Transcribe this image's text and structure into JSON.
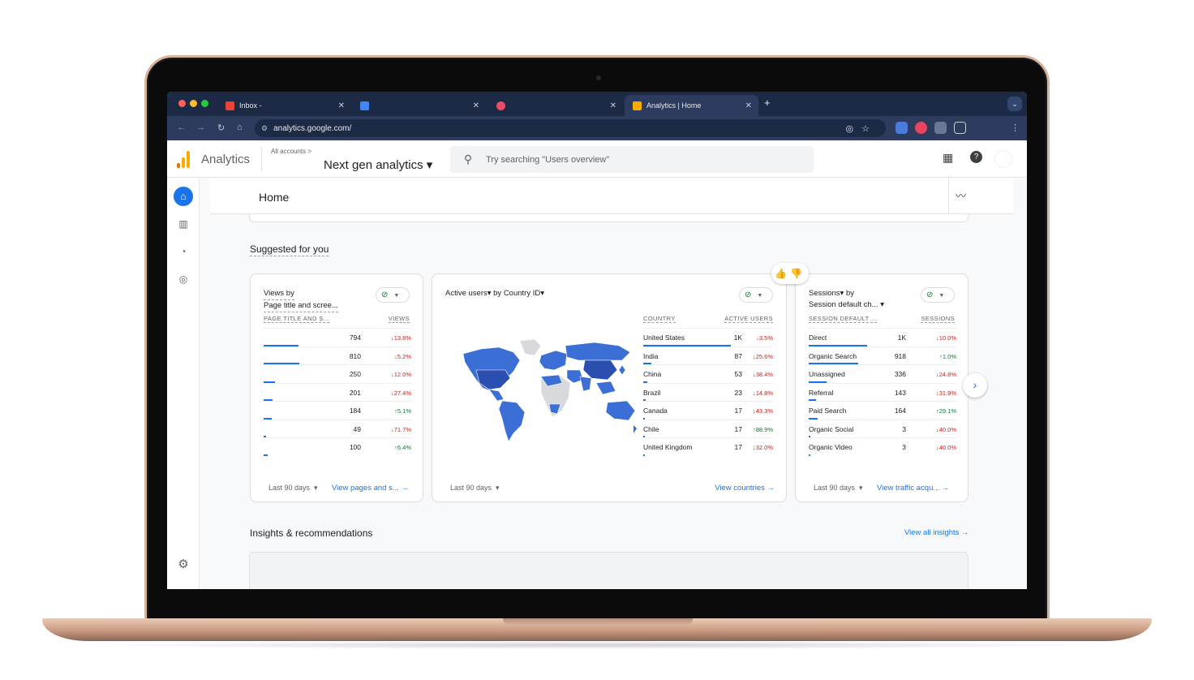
{
  "browser": {
    "tabs": [
      {
        "label": "Inbox -",
        "favicon_color": "#ea4335"
      },
      {
        "label": "",
        "favicon_color": "#4285f4"
      },
      {
        "label": "",
        "favicon_color": "#ea4c6a"
      },
      {
        "label": "Analytics | Home",
        "favicon_color": "#f9ab00"
      }
    ],
    "new_tab": "+",
    "url": "analytics.google.com/"
  },
  "ga_header": {
    "app_name": "Analytics",
    "all_accounts": "All accounts >",
    "property": "Next gen analytics ▾",
    "search_placeholder": "Try searching \"Users overview\""
  },
  "page": {
    "title": "Home"
  },
  "suggested": {
    "heading": "Suggested for you",
    "cards": [
      {
        "title_line1": "Views by",
        "title_line2": "Page title and scree...",
        "col_left": "PAGE TITLE AND S...",
        "col_right": "VIEWS",
        "rows": [
          {
            "label": "",
            "value": "794",
            "change": "↓13.8%",
            "dir": "down",
            "share": 0.98
          },
          {
            "label": "",
            "value": "810",
            "change": "↓5.2%",
            "dir": "down",
            "share": 1.0
          },
          {
            "label": "",
            "value": "250",
            "change": "↓12.0%",
            "dir": "down",
            "share": 0.31
          },
          {
            "label": "",
            "value": "201",
            "change": "↓27.4%",
            "dir": "down",
            "share": 0.25
          },
          {
            "label": "",
            "value": "184",
            "change": "↑5.1%",
            "dir": "up",
            "share": 0.23
          },
          {
            "label": "",
            "value": "49",
            "change": "↓71.7%",
            "dir": "down",
            "share": 0.06
          },
          {
            "label": "",
            "value": "100",
            "change": "↑6.4%",
            "dir": "up",
            "share": 0.12
          }
        ],
        "period": "Last 90 days",
        "link": "View pages and s... →"
      },
      {
        "title": "Active users▾ by Country ID▾",
        "col_left": "COUNTRY",
        "col_right": "ACTIVE USERS",
        "rows": [
          {
            "label": "United States",
            "value": "1K",
            "change": "↓3.5%",
            "dir": "down",
            "share": 1.0
          },
          {
            "label": "India",
            "value": "87",
            "change": "↓25.6%",
            "dir": "down",
            "share": 0.09
          },
          {
            "label": "China",
            "value": "53",
            "change": "↓38.4%",
            "dir": "down",
            "share": 0.05
          },
          {
            "label": "Brazil",
            "value": "23",
            "change": "↓14.8%",
            "dir": "down",
            "share": 0.03
          },
          {
            "label": "Canada",
            "value": "17",
            "change": "↓43.3%",
            "dir": "down",
            "share": 0.02
          },
          {
            "label": "Chile",
            "value": "17",
            "change": "↑88.9%",
            "dir": "up",
            "share": 0.02
          },
          {
            "label": "United Kingdom",
            "value": "17",
            "change": "↓32.0%",
            "dir": "down",
            "share": 0.02
          }
        ],
        "period": "Last 90 days",
        "link": "View countries →"
      },
      {
        "title_line1": "Sessions▾ by",
        "title_line2": "Session default ch... ▾",
        "col_left": "SESSION DEFAULT ...",
        "col_right": "SESSIONS",
        "rows": [
          {
            "label": "Direct",
            "value": "1K",
            "change": "↓10.0%",
            "dir": "down",
            "share": 1.0
          },
          {
            "label": "Organic Search",
            "value": "918",
            "change": "↑1.0%",
            "dir": "up",
            "share": 0.85
          },
          {
            "label": "Unassigned",
            "value": "336",
            "change": "↓24.8%",
            "dir": "down",
            "share": 0.31
          },
          {
            "label": "Referral",
            "value": "143",
            "change": "↓31.9%",
            "dir": "down",
            "share": 0.13
          },
          {
            "label": "Paid Search",
            "value": "164",
            "change": "↑29.1%",
            "dir": "up",
            "share": 0.15
          },
          {
            "label": "Organic Social",
            "value": "3",
            "change": "↓40.0%",
            "dir": "down",
            "share": 0.01
          },
          {
            "label": "Organic Video",
            "value": "3",
            "change": "↓40.0%",
            "dir": "down",
            "share": 0.01
          }
        ],
        "period": "Last 90 days",
        "link": "View traffic acqu... →"
      }
    ]
  },
  "insights": {
    "heading": "Insights & recommendations",
    "link": "View all insights →"
  },
  "colors": {
    "accent": "#1a73e8",
    "map_fill": "#3b6fd6",
    "map_empty": "#d7d9dd"
  }
}
